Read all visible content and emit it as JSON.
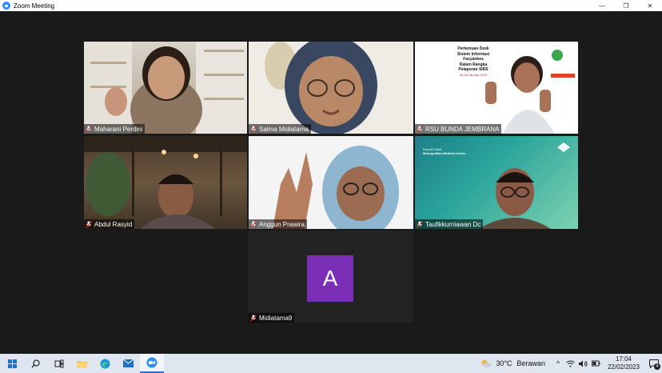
{
  "window": {
    "title": "Zoom Meeting",
    "controls": {
      "minimize": "—",
      "restore": "❐",
      "close": "✕"
    }
  },
  "participants": [
    {
      "name": "Maharani Perdini",
      "muted": true,
      "active": false
    },
    {
      "name": "Salma Midiatama",
      "muted": true,
      "active": true
    },
    {
      "name": "RSU BUNDA JEMBRANA",
      "muted": true,
      "active": false,
      "slide_text": [
        "Pertemuan Desk",
        "Sistem Informasi",
        "Fasyankes",
        "Dalam Rangka",
        "Pelaporan SIRS"
      ],
      "slide_date": "25-28 Januari 2023"
    },
    {
      "name": "Abdul Rasyid",
      "muted": true,
      "active": false
    },
    {
      "name": "Anggun Prawira",
      "muted": true,
      "active": false
    },
    {
      "name": "Taufikkurniawan Dc",
      "muted": true,
      "active": false,
      "background_text": [
        "Rumah Sakit",
        "Metropolitan Medical Centre"
      ]
    },
    {
      "name": "Midiatama9",
      "muted": true,
      "active": false,
      "avatar_letter": "A",
      "avatar_color": "#7a2fb6"
    }
  ],
  "taskbar": {
    "icons": [
      "windows-start-icon",
      "search-icon",
      "task-view-icon",
      "file-explorer-icon",
      "edge-browser-icon",
      "mail-icon",
      "zoom-app-icon"
    ],
    "weather": {
      "temperature": "30°C",
      "condition": "Berawan"
    },
    "tray_chevron": "^",
    "clock": {
      "time": "17:04",
      "date": "22/02/2023"
    },
    "notification_count": "4"
  }
}
